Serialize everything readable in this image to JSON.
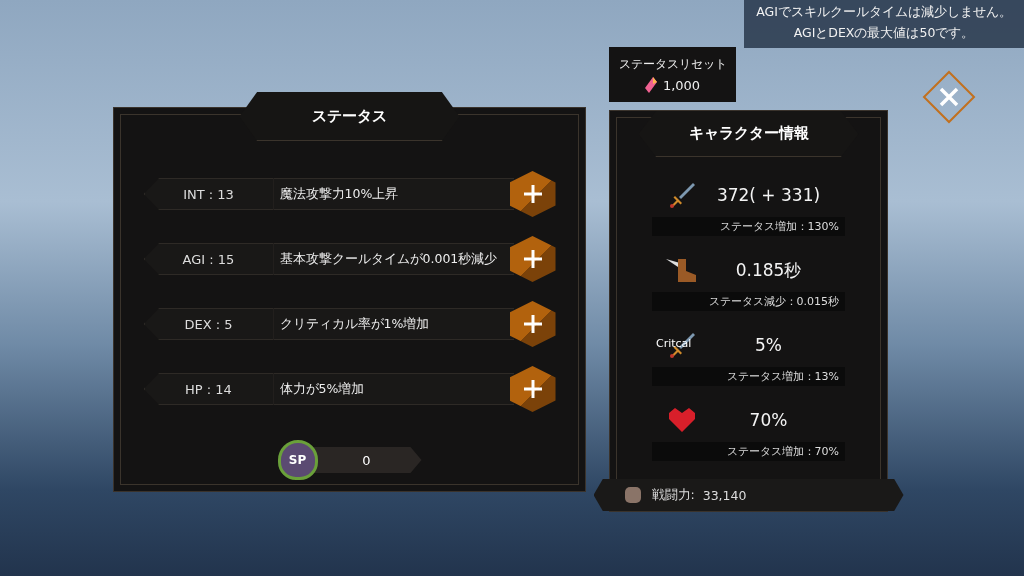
{
  "notice": [
    "AGIでスキルクールタイムは減少しません。",
    "AGIとDEXの最大値は50です。"
  ],
  "reset": {
    "label": "ステータスリセット",
    "cost": "1,000"
  },
  "status_panel": {
    "title": "ステータス",
    "stats": [
      {
        "label": "INT : 13",
        "effect": "魔法攻撃力10%上昇"
      },
      {
        "label": "AGI : 15",
        "effect": "基本攻撃クールタイムが0.001秒減少"
      },
      {
        "label": "DEX : 5",
        "effect": "クリティカル率が1%増加"
      },
      {
        "label": "HP : 14",
        "effect": "体力が5%増加"
      }
    ],
    "sp_badge": "SP",
    "sp": "0"
  },
  "character_panel": {
    "title": "キャラクター情報",
    "stats": [
      {
        "kind": "attack",
        "value": "372( + 331)",
        "detail": "ステータス増加：130%"
      },
      {
        "kind": "speed",
        "value": "0.185秒",
        "detail": "ステータス減少：0.015秒"
      },
      {
        "kind": "critical",
        "icon_label": "Critcal",
        "value": "5%",
        "detail": "ステータス増加：13%"
      },
      {
        "kind": "health",
        "value": "70%",
        "detail": "ステータス増加：70%"
      }
    ],
    "power_label": "戦闘力:",
    "power": "33,140"
  }
}
